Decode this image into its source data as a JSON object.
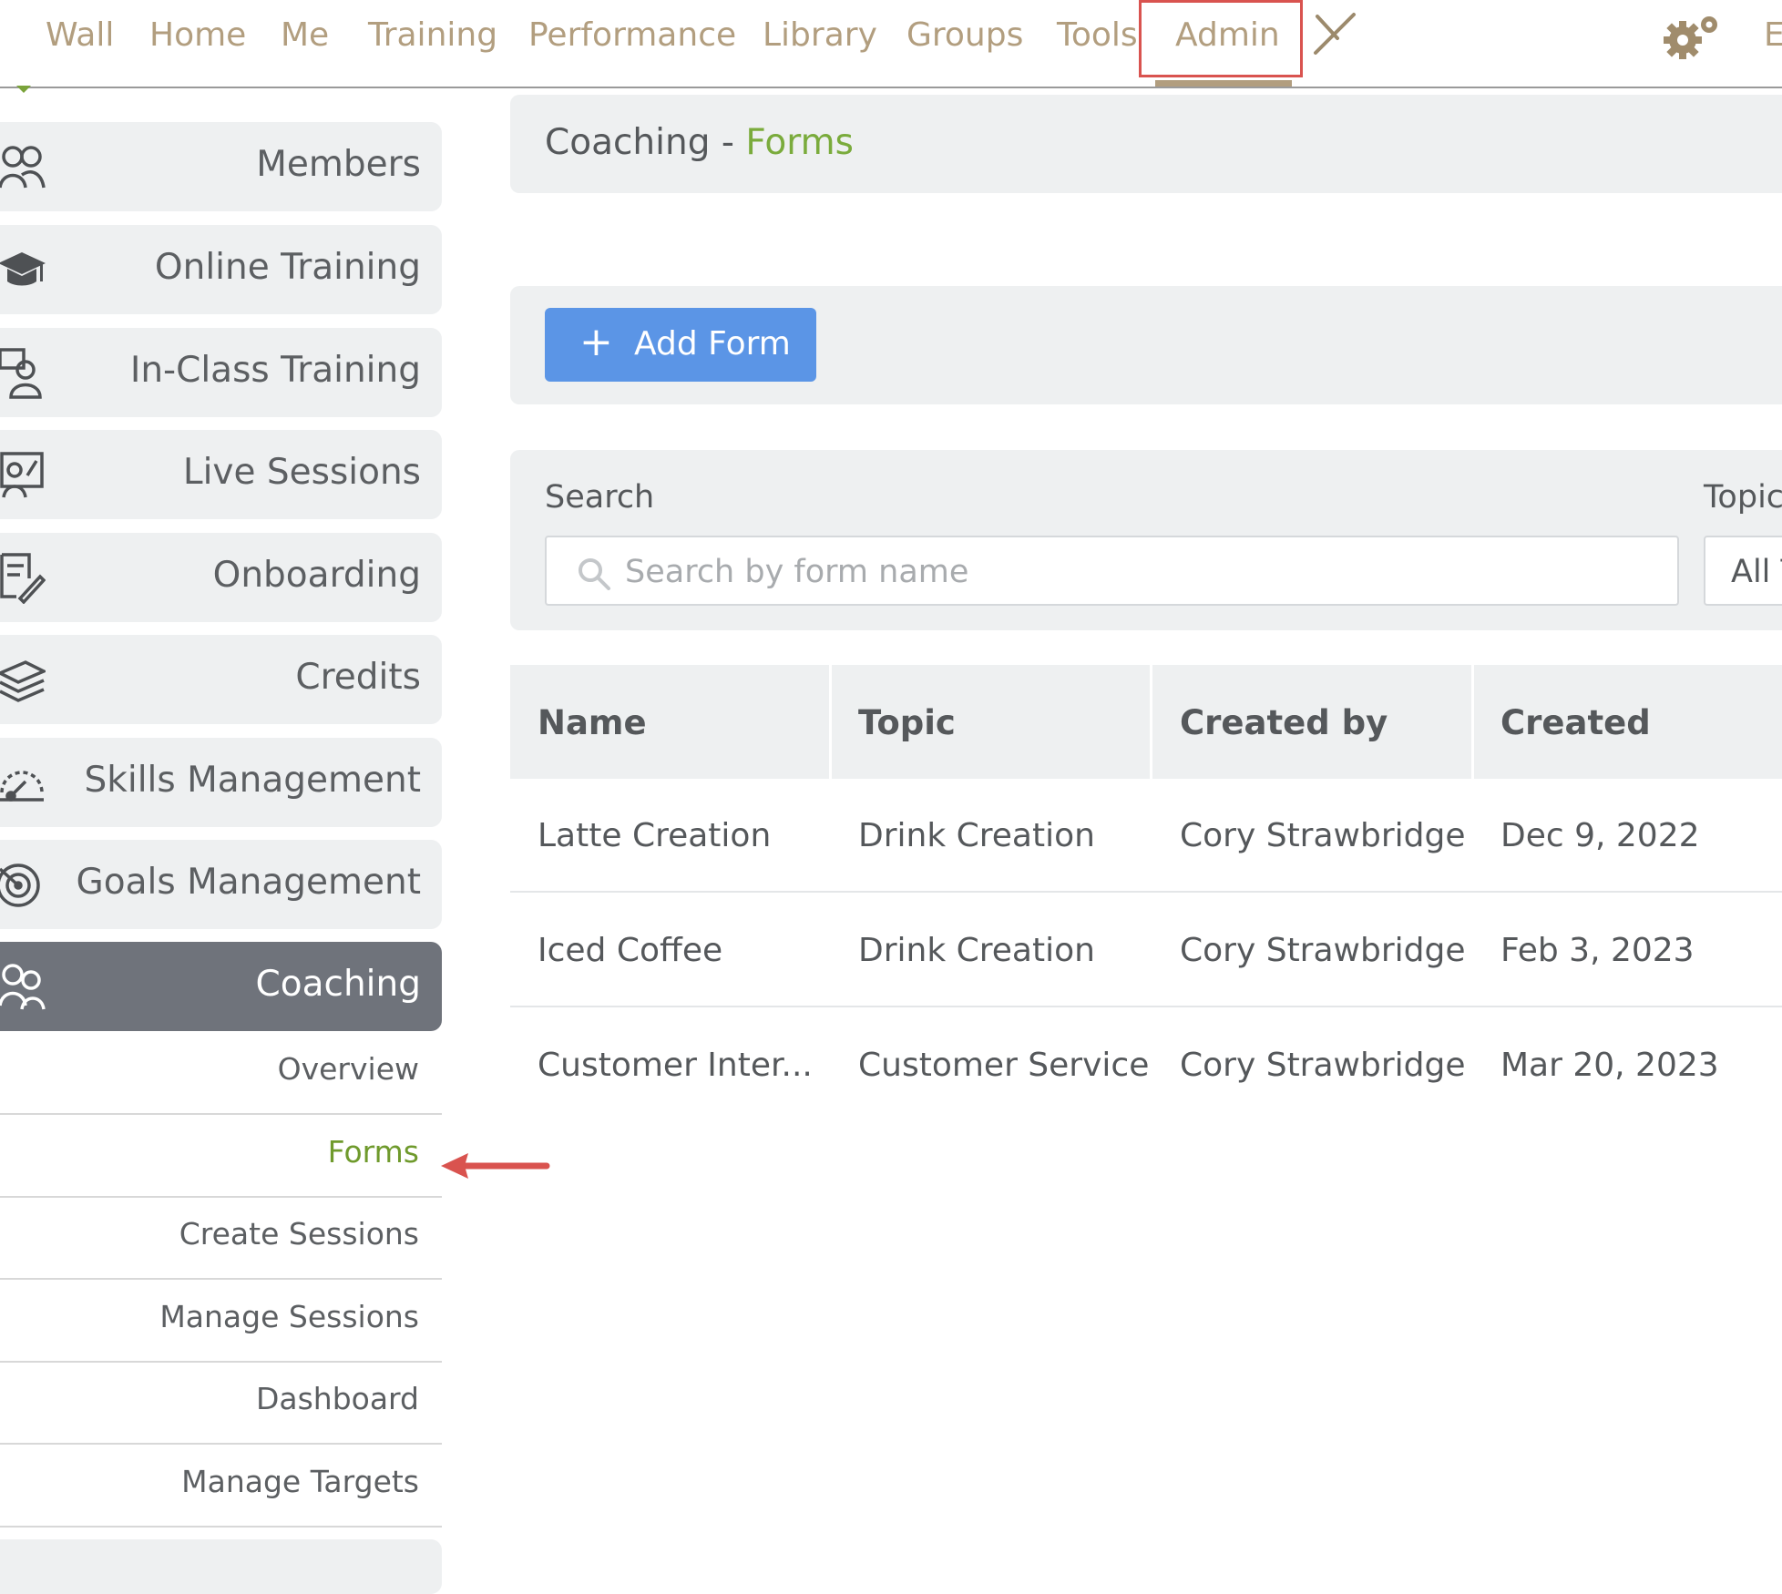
{
  "nav": {
    "items": [
      "Wall",
      "Home",
      "Me",
      "Training",
      "Performance",
      "Library",
      "Groups",
      "Tools",
      "Admin"
    ],
    "partial_right": "E"
  },
  "sidebar": {
    "items": [
      {
        "label": "Members",
        "icon": "members-icon"
      },
      {
        "label": "Online Training",
        "icon": "graduation-cap-icon"
      },
      {
        "label": "In-Class Training",
        "icon": "classroom-icon"
      },
      {
        "label": "Live Sessions",
        "icon": "presentation-icon"
      },
      {
        "label": "Onboarding",
        "icon": "checklist-icon"
      },
      {
        "label": "Credits",
        "icon": "stack-icon"
      },
      {
        "label": "Skills Management",
        "icon": "gauge-icon"
      },
      {
        "label": "Goals Management",
        "icon": "target-icon"
      },
      {
        "label": "Coaching",
        "icon": "coaching-icon"
      }
    ],
    "subitems": [
      "Overview",
      "Forms",
      "Create Sessions",
      "Manage Sessions",
      "Dashboard",
      "Manage Targets"
    ],
    "current_subitem": "Forms"
  },
  "page": {
    "title_prefix": "Coaching - ",
    "title_accent": "Forms"
  },
  "toolbar": {
    "add_icon": "+",
    "add_label": "Add Form"
  },
  "filters": {
    "search_label": "Search",
    "search_placeholder": "Search by form name",
    "topic_label": "Topic",
    "topic_value": "All Topics"
  },
  "table": {
    "columns": [
      "Name",
      "Topic",
      "Created by",
      "Created"
    ],
    "rows": [
      [
        "Latte Creation",
        "Drink Creation",
        "Cory Strawbridge",
        "Dec 9, 2022"
      ],
      [
        "Iced Coffee",
        "Drink Creation",
        "Cory Strawbridge",
        "Feb 3, 2023"
      ],
      [
        "Customer Inter...",
        "Customer Service",
        "Cory Strawbridge",
        "Mar 20, 2023"
      ]
    ]
  },
  "colors": {
    "nav_text": "#b29e7f",
    "accent_green": "#7aab3c",
    "button_blue": "#5b95e6",
    "highlight_red": "#d9534f",
    "active_sidebar": "#6f737b"
  }
}
